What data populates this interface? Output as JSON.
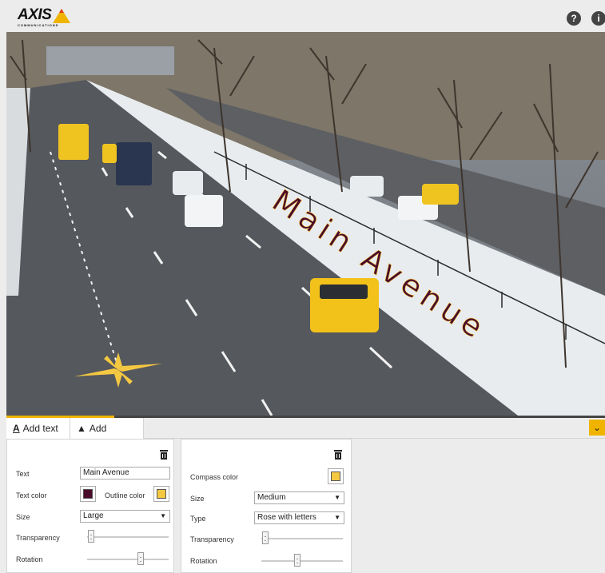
{
  "header": {
    "logo_text": "AXIS",
    "logo_subtext": "COMMUNICATIONS",
    "help_icon_glyph": "?",
    "info_icon_glyph": "i"
  },
  "overlay": {
    "text": "Main Avenue",
    "text_color": "#4a0a2a",
    "outline_color": "#f5c842"
  },
  "tabs": [
    {
      "label": "Add text",
      "icon": "text-underline-icon"
    },
    {
      "label": "Add compass",
      "icon": "compass-arrow-icon"
    }
  ],
  "text_panel": {
    "text_label": "Text",
    "text_value": "Main Avenue",
    "text_color_label": "Text color",
    "text_color": "#4a0a2a",
    "outline_color_label": "Outline color",
    "outline_color": "#f5c842",
    "size_label": "Size",
    "size_value": "Large",
    "transparency_label": "Transparency",
    "transparency_level": 0,
    "rotation_label": "Rotation",
    "rotation_level": 0.65
  },
  "compass_panel": {
    "compass_color_label": "Compass color",
    "compass_color": "#f5c842",
    "size_label": "Size",
    "size_value": "Medium",
    "type_label": "Type",
    "type_value": "Rose with letters",
    "transparency_label": "Transparency",
    "transparency_level": 0,
    "rotation_label": "Rotation",
    "rotation_level": 0.45
  },
  "colors": {
    "accent": "#f0b400",
    "topbar": "#ececec"
  }
}
